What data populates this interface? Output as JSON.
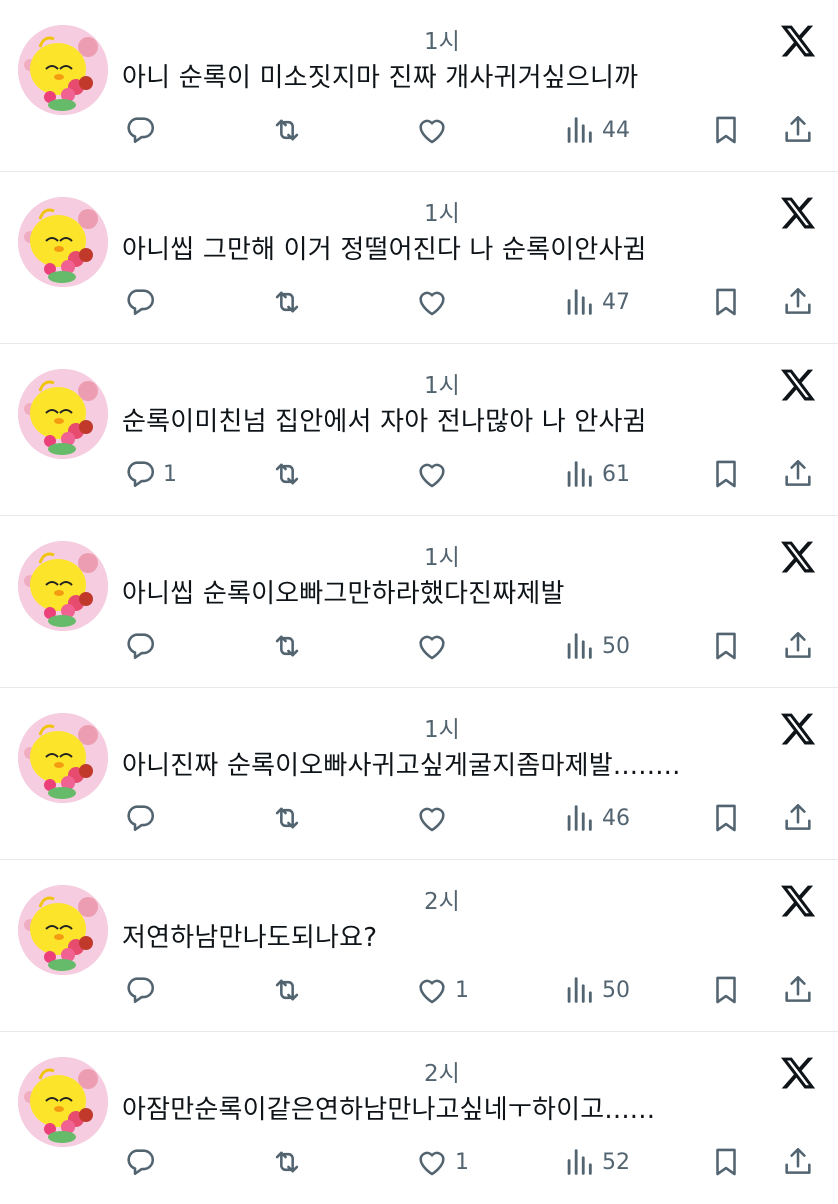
{
  "tweets": [
    {
      "time": "1시",
      "text": "아니 순록이 미소짓지마 진짜 개사귀거싶으니까",
      "reply_count": "",
      "like_count": "",
      "views": "44"
    },
    {
      "time": "1시",
      "text": "아니씹 그만해 이거 정떨어진다 나 순록이안사귐",
      "reply_count": "",
      "like_count": "",
      "views": "47"
    },
    {
      "time": "1시",
      "text": "순록이미친넘 집안에서 자아 전나많아 나 안사귐",
      "reply_count": "1",
      "like_count": "",
      "views": "61"
    },
    {
      "time": "1시",
      "text": "아니씹 순록이오빠그만하라했다진짜제발",
      "reply_count": "",
      "like_count": "",
      "views": "50"
    },
    {
      "time": "1시",
      "text": "아니진짜 순록이오빠사귀고싶게굴지좀마제발........",
      "reply_count": "",
      "like_count": "",
      "views": "46"
    },
    {
      "time": "2시",
      "text": "저연하남만나도되나요?",
      "reply_count": "",
      "like_count": "1",
      "views": "50"
    },
    {
      "time": "2시",
      "text": "아잠만순록이같은연하남만나고싶네ㅜ하이고......",
      "reply_count": "",
      "like_count": "1",
      "views": "52"
    }
  ],
  "icons": {
    "avatar": "yellow-bird-avatar-icon",
    "logo": "x-logo-icon",
    "reply": "reply-icon",
    "retweet": "retweet-icon",
    "like": "heart-icon",
    "views": "views-icon",
    "bookmark": "bookmark-icon",
    "share": "share-icon"
  },
  "colors": {
    "text": "#0f1419",
    "secondary": "#536471",
    "divider": "#e7e9ea",
    "avatar_bg": "#f3c9dc"
  }
}
